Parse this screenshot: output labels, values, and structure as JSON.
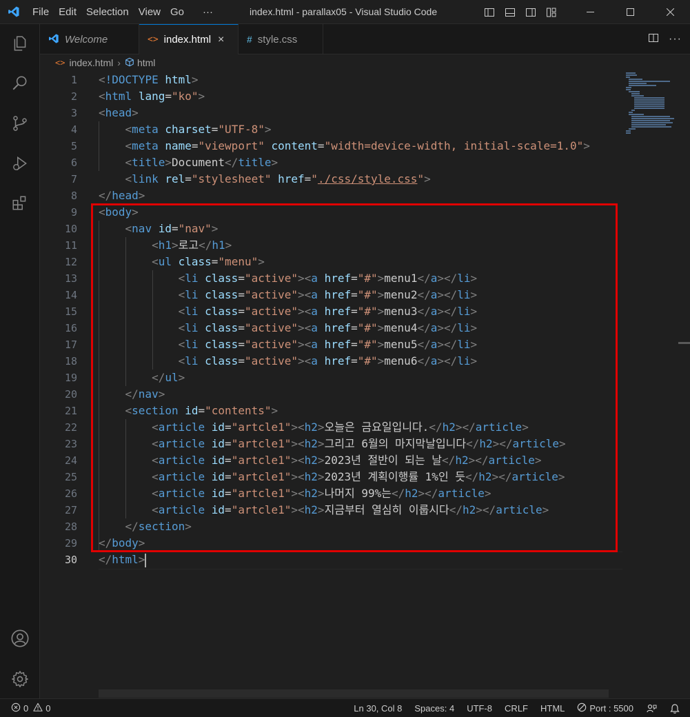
{
  "titlebar": {
    "menu": [
      "File",
      "Edit",
      "Selection",
      "View",
      "Go",
      "···"
    ],
    "title": "index.html - parallax05 - Visual Studio Code",
    "window_controls": [
      "minimize-icon",
      "maximize-icon",
      "close-icon"
    ]
  },
  "activity_bar": {
    "top_items": [
      "explorer-icon",
      "search-icon",
      "source-control-icon",
      "run-debug-icon",
      "extensions-icon"
    ],
    "bottom_items": [
      "account-icon",
      "settings-gear-icon"
    ]
  },
  "tabs": [
    {
      "label": "Welcome",
      "icon": "vscode-icon",
      "active": false
    },
    {
      "label": "index.html",
      "icon": "html-icon",
      "active": true,
      "close": "×"
    },
    {
      "label": "style.css",
      "icon": "css-icon",
      "active": false
    }
  ],
  "breadcrumb": {
    "file": "index.html",
    "symbol": "html"
  },
  "editor": {
    "line_numbers": [
      "1",
      "2",
      "3",
      "4",
      "5",
      "6",
      "7",
      "8",
      "9",
      "10",
      "11",
      "12",
      "13",
      "14",
      "15",
      "16",
      "17",
      "18",
      "19",
      "20",
      "21",
      "22",
      "23",
      "24",
      "25",
      "26",
      "27",
      "28",
      "29",
      "30"
    ],
    "current_line": "30",
    "text": {
      "doctype": "!DOCTYPE",
      "html": "html",
      "lang_attr": "lang",
      "lang_val": "\"ko\"",
      "head": "head",
      "meta": "meta",
      "charset_attr": "charset",
      "charset_val": "\"UTF-8\"",
      "name_attr": "name",
      "viewport_val": "\"viewport\"",
      "content_attr": "content",
      "content_val": "\"width=device-width, initial-scale=1.0\"",
      "title": "title",
      "title_text": "Document",
      "link": "link",
      "rel_attr": "rel",
      "rel_val": "\"stylesheet\"",
      "href_attr": "href",
      "href_q": "\"",
      "href_path": "./css/style.css",
      "body": "body",
      "nav": "nav",
      "id_attr": "id",
      "nav_id": "\"nav\"",
      "h1": "h1",
      "logo": "로고",
      "ul": "ul",
      "class_attr": "class",
      "menu_val": "\"menu\"",
      "li": "li",
      "active_val": "\"active\"",
      "a": "a",
      "hash_val": "\"#\"",
      "section": "section",
      "contents_val": "\"contents\"",
      "article": "article",
      "artcle_val": "\"artcle1\"",
      "h2": "h2"
    },
    "menu_items": [
      "menu1",
      "menu2",
      "menu3",
      "menu4",
      "menu5",
      "menu6"
    ],
    "articles": [
      "오늘은 금요일입니다.",
      "그리고 6월의 마지막날입니다",
      "2023년 절반이 되는 날",
      "2023년 계획이행률 1%인 듯",
      "나머지 99%는",
      "지금부터 열심히 이룹시다"
    ]
  },
  "statusbar": {
    "errors": "0",
    "warnings": "0",
    "position": "Ln 30, Col 8",
    "spaces": "Spaces: 4",
    "encoding": "UTF-8",
    "eol": "CRLF",
    "language": "HTML",
    "port": "Port : 5500"
  },
  "colors": {
    "tag": "#569cd6",
    "attribute": "#9cdcfe",
    "string": "#ce9178",
    "bracket": "#808080",
    "highlight_box": "#e00000",
    "accent": "#0078d4"
  }
}
